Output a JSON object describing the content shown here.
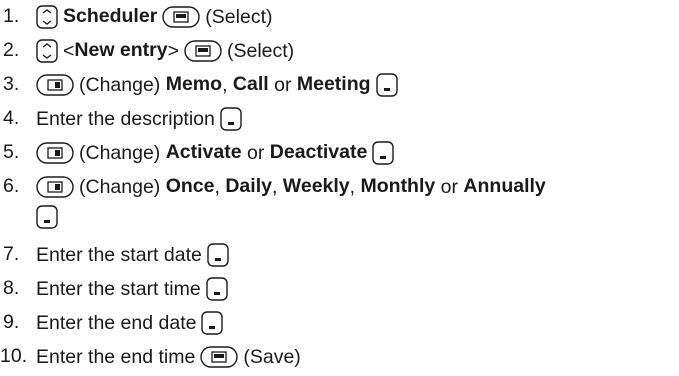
{
  "steps": [
    {
      "number": "1.",
      "pre": "",
      "bold1": "Scheduler",
      "post": "(Select)"
    },
    {
      "number": "2.",
      "pre": "<",
      "bold1": "New entry",
      "mid": ">",
      "post": "(Select)"
    },
    {
      "number": "3.",
      "change": "(Change)",
      "bold1": "Memo",
      "sep1": ",",
      "bold2": "Call",
      "sep2": "or",
      "bold3": "Meeting"
    },
    {
      "number": "4.",
      "text": "Enter the description"
    },
    {
      "number": "5.",
      "change": "(Change)",
      "bold1": "Activate",
      "sep1": "or",
      "bold2": "Deactivate"
    },
    {
      "number": "6.",
      "change": "(Change)",
      "bold1": "Once",
      "sep1": ",",
      "bold2": "Daily",
      "sep2": ",",
      "bold3": "Weekly",
      "sep3": ",",
      "bold4": "Monthly",
      "sep4": "or",
      "bold5": "Annually"
    },
    {
      "number": "7.",
      "text": "Enter the start date"
    },
    {
      "number": "8.",
      "text": "Enter the start time"
    },
    {
      "number": "9.",
      "text": "Enter the end date"
    },
    {
      "number": "10.",
      "text": "Enter the end time",
      "post": "(Save)"
    }
  ],
  "icons": {
    "nav": "navigation-key-icon",
    "softkey": "display-key-icon",
    "enter": "enter-key-icon"
  }
}
